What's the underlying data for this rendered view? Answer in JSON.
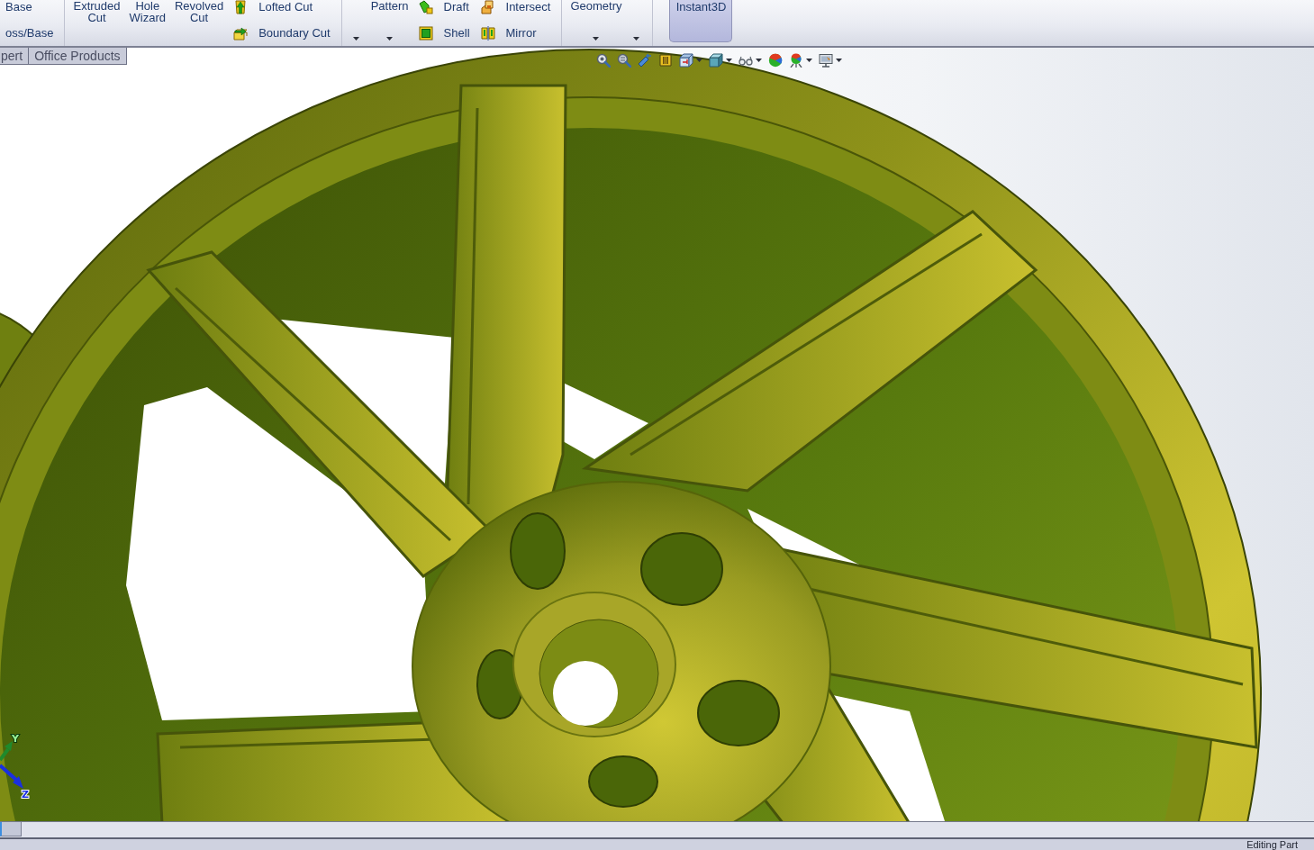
{
  "ribbon": {
    "sections": [
      {
        "columns": [
          {
            "kind": "small",
            "items": [
              {
                "kind": "plain",
                "label": "Base"
              },
              {
                "kind": "plain",
                "label": "oss/Base"
              }
            ]
          }
        ]
      },
      {
        "columns": [
          {
            "kind": "large",
            "lines": [
              "Extruded",
              "Cut"
            ],
            "dropdown": false
          },
          {
            "kind": "large",
            "lines": [
              "Hole",
              "Wizard"
            ],
            "dropdown": false
          },
          {
            "kind": "large",
            "lines": [
              "Revolved",
              "Cut"
            ],
            "dropdown": false
          },
          {
            "kind": "small",
            "items": [
              {
                "kind": "icon",
                "label": "Lofted Cut"
              },
              {
                "kind": "icon",
                "label": "Boundary Cut"
              }
            ]
          }
        ]
      },
      {
        "columns": [
          {
            "kind": "large",
            "dropdown": true
          },
          {
            "kind": "large",
            "lines": [
              "Pattern"
            ],
            "dropdown": true
          },
          {
            "kind": "small",
            "items": [
              {
                "kind": "icon",
                "label": "Draft"
              },
              {
                "kind": "icon",
                "label": "Shell"
              }
            ]
          },
          {
            "kind": "small",
            "items": [
              {
                "kind": "icon",
                "label": "Intersect"
              },
              {
                "kind": "icon",
                "label": "Mirror"
              }
            ]
          }
        ]
      },
      {
        "columns": [
          {
            "kind": "large",
            "lines": [
              "Geometry"
            ],
            "dropdown": true
          },
          {
            "kind": "large",
            "dropdown": true
          }
        ]
      }
    ],
    "instant3d": {
      "label": "Instant3D",
      "on": true
    }
  },
  "tabs": [
    {
      "label": "pert",
      "selected": false
    },
    {
      "label": "Office Products",
      "selected": false
    }
  ],
  "view_toolbar": [
    {
      "dropdown": false
    },
    {
      "dropdown": false
    },
    {
      "dropdown": false
    },
    {
      "dropdown": false
    },
    {
      "dropdown": true
    },
    {
      "dropdown": true
    },
    {
      "dropdown": true
    },
    {
      "dropdown": false
    },
    {
      "dropdown": true
    },
    {
      "dropdown": true
    }
  ],
  "triad": {
    "axes": [
      {
        "label": "Y"
      },
      {
        "label": "Z"
      }
    ]
  },
  "status_bar": {
    "text": "Editing Part"
  }
}
